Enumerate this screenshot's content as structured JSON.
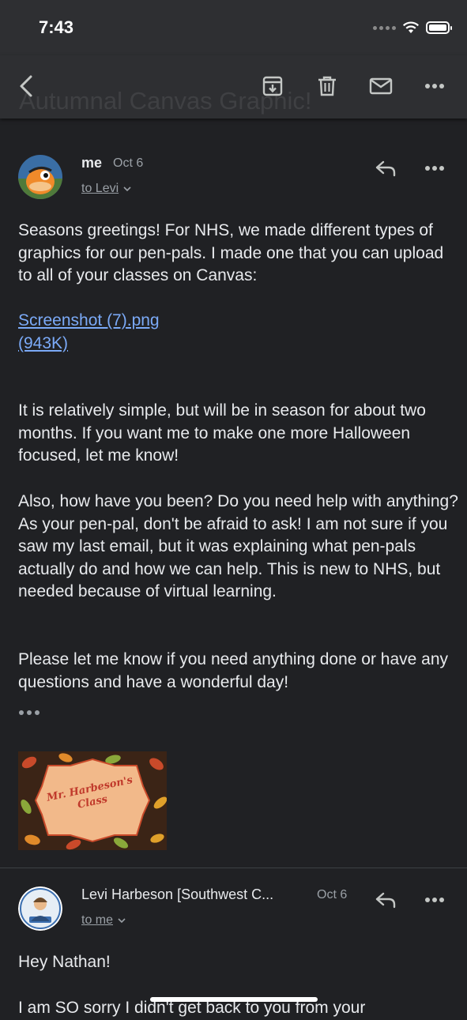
{
  "status_bar": {
    "time": "7:43"
  },
  "toolbar": {
    "subject": "Autumnal Canvas Graphic!",
    "back": "back-arrow-icon",
    "archive": "archive-icon",
    "delete": "trash-icon",
    "mark_unread": "mail-icon",
    "more": "more-horizontal-icon"
  },
  "message1": {
    "sender": "me",
    "date": "Oct 6",
    "to": "to Levi",
    "paragraphs": [
      "Seasons greetings! For NHS, we made different types of graphics for our pen-pals. I made one that you can upload to all of your classes on Canvas:",
      "It is relatively simple, but will be in season for about two months. If you want me to make one more Halloween focused, let me know!",
      "Also, how have you been? Do you need help with anything? As your pen-pal, don't be afraid to ask! I am not sure if you saw my last email, but it was explaining what pen-pals actually do and how we can help. This is new to NHS, but needed because of virtual learning.",
      "Please let me know if you need anything done or have any questions and have a wonderful day!"
    ],
    "attachment": {
      "name": "Screenshot (7).png",
      "size": "(943K)"
    },
    "image_text": "Mr. Harbeson's Class"
  },
  "message2": {
    "sender": "Levi Harbeson [Southwest C...",
    "date": "Oct 6",
    "to": "to me",
    "paragraphs": [
      "Hey Nathan!",
      "I am SO sorry I didn't get back to you from your"
    ]
  },
  "colors": {
    "background": "#202124",
    "bar": "#2e2f32",
    "text": "#e8eaed",
    "muted": "#9aa0a6",
    "link": "#7baaf7"
  }
}
